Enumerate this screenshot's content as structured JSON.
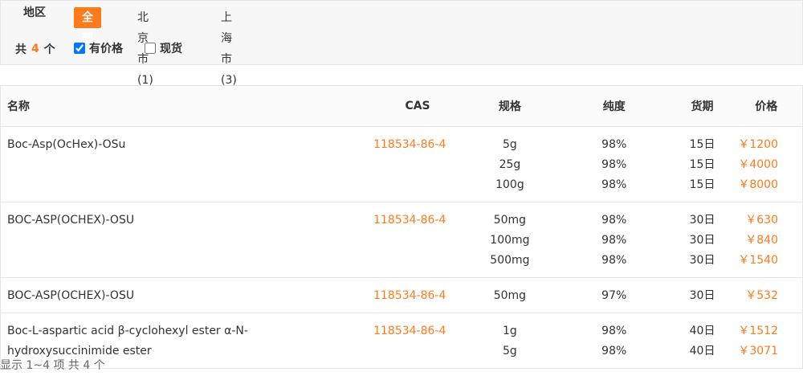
{
  "filters": {
    "region_label": "地区",
    "regions": [
      {
        "label": "全部",
        "active": true
      },
      {
        "label": "北京市(1)",
        "active": false
      },
      {
        "label": "上海市(3)",
        "active": false
      }
    ],
    "count_prefix": "共",
    "count_value": "4",
    "count_suffix": "个",
    "has_price_label": "有价格",
    "has_price_checked": true,
    "in_stock_label": "现货",
    "in_stock_checked": false
  },
  "table": {
    "headers": {
      "name": "名称",
      "cas": "CAS",
      "spec": "规格",
      "purity": "纯度",
      "lead": "货期",
      "price": "价格"
    },
    "rows": [
      {
        "name": "Boc-Asp(OcHex)-OSu",
        "cas": "118534-86-4",
        "items": [
          {
            "spec": "5g",
            "purity": "98%",
            "lead": "15日",
            "price": "￥1200"
          },
          {
            "spec": "25g",
            "purity": "98%",
            "lead": "15日",
            "price": "￥4000"
          },
          {
            "spec": "100g",
            "purity": "98%",
            "lead": "15日",
            "price": "￥8000"
          }
        ]
      },
      {
        "name": "BOC-ASP(OCHEX)-OSU",
        "cas": "118534-86-4",
        "items": [
          {
            "spec": "50mg",
            "purity": "98%",
            "lead": "30日",
            "price": "￥630"
          },
          {
            "spec": "100mg",
            "purity": "98%",
            "lead": "30日",
            "price": "￥840"
          },
          {
            "spec": "500mg",
            "purity": "98%",
            "lead": "30日",
            "price": "￥1540"
          }
        ]
      },
      {
        "name": "BOC-ASP(OCHEX)-OSU",
        "cas": "118534-86-4",
        "items": [
          {
            "spec": "50mg",
            "purity": "97%",
            "lead": "30日",
            "price": "￥532"
          }
        ]
      },
      {
        "name": "Boc-L-aspartic acid β-cyclohexyl ester α-N-hydroxysuccinimide ester",
        "cas": "118534-86-4",
        "items": [
          {
            "spec": "1g",
            "purity": "98%",
            "lead": "40日",
            "price": "￥1512"
          },
          {
            "spec": "5g",
            "purity": "98%",
            "lead": "40日",
            "price": "￥3071"
          }
        ]
      }
    ]
  },
  "footer": {
    "summary": "显示 1~4 项 共 4 个"
  },
  "colors": {
    "accent": "#ff7a1a",
    "border": "#e6e6e6",
    "panel_bg": "#f7f7f7"
  }
}
